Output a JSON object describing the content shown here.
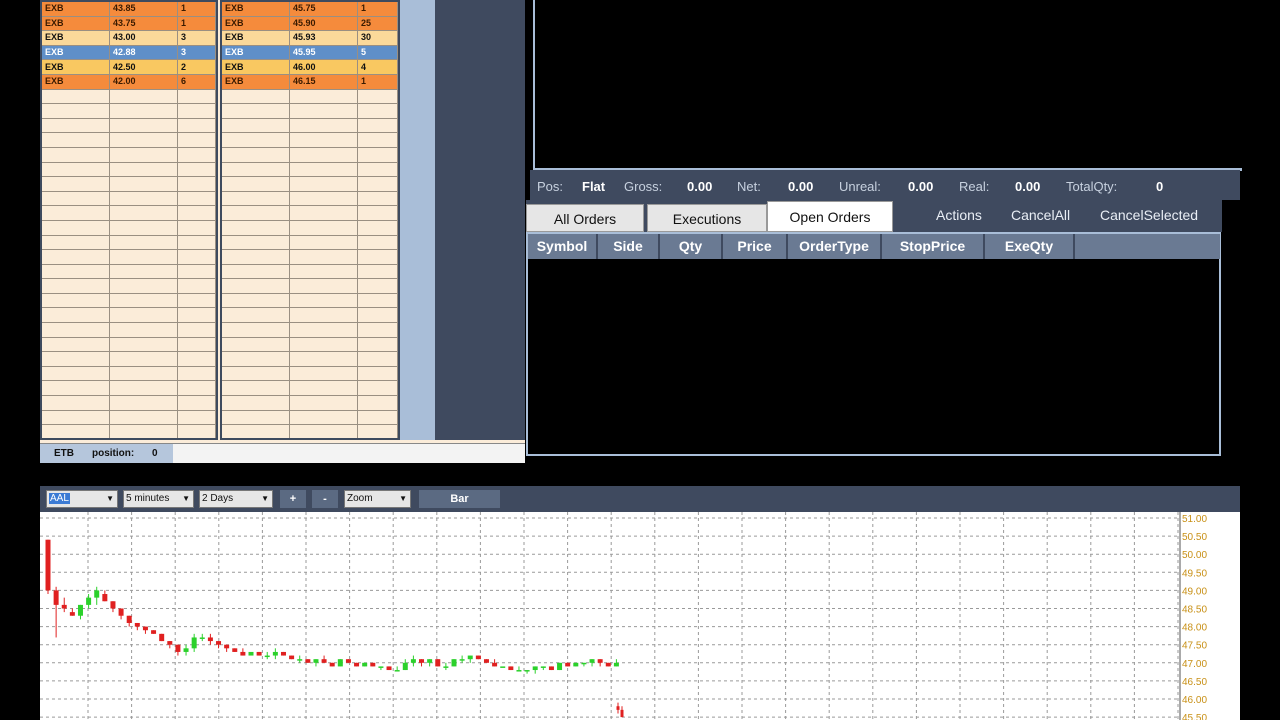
{
  "bid_book": {
    "rows": [
      {
        "ex": "EXB",
        "price": "43.85",
        "size": "1",
        "style": "orange"
      },
      {
        "ex": "EXB",
        "price": "43.75",
        "size": "1",
        "style": "orange"
      },
      {
        "ex": "EXB",
        "price": "43.00",
        "size": "3",
        "style": "light"
      },
      {
        "ex": "EXB",
        "price": "42.88",
        "size": "3",
        "style": "blue"
      },
      {
        "ex": "EXB",
        "price": "42.50",
        "size": "2",
        "style": "yellow"
      },
      {
        "ex": "EXB",
        "price": "42.00",
        "size": "6",
        "style": "orange"
      }
    ]
  },
  "ask_book": {
    "rows": [
      {
        "ex": "EXB",
        "price": "45.75",
        "size": "1",
        "style": "orange"
      },
      {
        "ex": "EXB",
        "price": "45.90",
        "size": "25",
        "style": "orange"
      },
      {
        "ex": "EXB",
        "price": "45.93",
        "size": "30",
        "style": "light"
      },
      {
        "ex": "EXB",
        "price": "45.95",
        "size": "5",
        "style": "blue"
      },
      {
        "ex": "EXB",
        "price": "46.00",
        "size": "4",
        "style": "yellow"
      },
      {
        "ex": "EXB",
        "price": "46.15",
        "size": "1",
        "style": "orange"
      }
    ]
  },
  "l2_status": {
    "symbol": "ETB",
    "position_label": "position:",
    "position_value": "0"
  },
  "position_bar": {
    "pos_label": "Pos:",
    "pos_value": "Flat",
    "gross_label": "Gross:",
    "gross_value": "0.00",
    "net_label": "Net:",
    "net_value": "0.00",
    "unreal_label": "Unreal:",
    "unreal_value": "0.00",
    "real_label": "Real:",
    "real_value": "0.00",
    "totalqty_label": "TotalQty:",
    "totalqty_value": "0"
  },
  "orders": {
    "tabs": [
      "All Orders",
      "Executions",
      "Open Orders"
    ],
    "active_tab": "Open Orders",
    "actions": [
      "Actions",
      "CancelAll",
      "CancelSelected"
    ],
    "columns": [
      "Symbol",
      "Side",
      "Qty",
      "Price",
      "OrderType",
      "StopPrice",
      "ExeQty"
    ]
  },
  "chart_toolbar": {
    "symbol": "AAL",
    "interval": "5 minutes",
    "range": "2 Days",
    "plus": "+",
    "minus": "-",
    "zoom": "Zoom",
    "bar": "Bar"
  },
  "chart_data": {
    "type": "candlestick",
    "ylim": [
      45.5,
      51.0
    ],
    "y_ticks": [
      "51.00",
      "50.50",
      "50.00",
      "49.50",
      "49.00",
      "48.50",
      "48.00",
      "47.50",
      "47.00",
      "46.50",
      "46.00",
      "45.50"
    ],
    "up_color": "#2bd12b",
    "down_color": "#e02020",
    "grid": "dashed",
    "candles": [
      [
        50.4,
        50.4,
        48.9,
        49.0
      ],
      [
        49.0,
        49.1,
        47.7,
        48.6
      ],
      [
        48.6,
        48.8,
        48.4,
        48.5
      ],
      [
        48.4,
        48.5,
        48.3,
        48.3
      ],
      [
        48.3,
        48.6,
        48.2,
        48.6
      ],
      [
        48.6,
        48.9,
        48.5,
        48.8
      ],
      [
        48.8,
        49.1,
        48.6,
        49.0
      ],
      [
        48.9,
        49.0,
        48.7,
        48.7
      ],
      [
        48.7,
        48.7,
        48.4,
        48.5
      ],
      [
        48.5,
        48.5,
        48.2,
        48.3
      ],
      [
        48.3,
        48.3,
        48.0,
        48.1
      ],
      [
        48.1,
        48.1,
        47.9,
        48.0
      ],
      [
        48.0,
        48.0,
        47.8,
        47.9
      ],
      [
        47.9,
        47.9,
        47.8,
        47.8
      ],
      [
        47.8,
        47.8,
        47.6,
        47.6
      ],
      [
        47.6,
        47.6,
        47.4,
        47.5
      ],
      [
        47.5,
        47.5,
        47.2,
        47.3
      ],
      [
        47.3,
        47.5,
        47.2,
        47.4
      ],
      [
        47.4,
        47.8,
        47.3,
        47.7
      ],
      [
        47.7,
        47.8,
        47.6,
        47.7
      ],
      [
        47.7,
        47.8,
        47.5,
        47.6
      ],
      [
        47.6,
        47.6,
        47.4,
        47.5
      ],
      [
        47.5,
        47.5,
        47.3,
        47.4
      ],
      [
        47.4,
        47.4,
        47.3,
        47.3
      ],
      [
        47.3,
        47.4,
        47.2,
        47.2
      ],
      [
        47.2,
        47.3,
        47.2,
        47.3
      ],
      [
        47.3,
        47.3,
        47.2,
        47.2
      ],
      [
        47.2,
        47.3,
        47.1,
        47.2
      ],
      [
        47.2,
        47.4,
        47.1,
        47.3
      ],
      [
        47.3,
        47.3,
        47.2,
        47.2
      ],
      [
        47.2,
        47.2,
        47.1,
        47.1
      ],
      [
        47.1,
        47.2,
        47.0,
        47.1
      ],
      [
        47.1,
        47.1,
        47.0,
        47.0
      ],
      [
        47.0,
        47.1,
        46.9,
        47.1
      ],
      [
        47.1,
        47.2,
        47.0,
        47.0
      ],
      [
        47.0,
        47.0,
        46.9,
        46.9
      ],
      [
        46.9,
        47.1,
        46.9,
        47.1
      ],
      [
        47.1,
        47.1,
        47.0,
        47.0
      ],
      [
        47.0,
        47.0,
        46.9,
        46.9
      ],
      [
        46.9,
        47.0,
        46.9,
        47.0
      ],
      [
        47.0,
        47.0,
        46.9,
        46.9
      ],
      [
        46.9,
        46.9,
        46.8,
        46.9
      ],
      [
        46.9,
        46.9,
        46.8,
        46.8
      ],
      [
        46.8,
        46.9,
        46.8,
        46.8
      ],
      [
        46.8,
        47.1,
        46.8,
        47.0
      ],
      [
        47.0,
        47.2,
        46.9,
        47.1
      ],
      [
        47.1,
        47.1,
        46.9,
        47.0
      ],
      [
        47.0,
        47.1,
        46.9,
        47.1
      ],
      [
        47.1,
        47.1,
        46.9,
        46.9
      ],
      [
        46.9,
        47.0,
        46.8,
        46.9
      ],
      [
        46.9,
        47.1,
        46.9,
        47.1
      ],
      [
        47.1,
        47.2,
        47.0,
        47.1
      ],
      [
        47.1,
        47.2,
        47.0,
        47.2
      ],
      [
        47.2,
        47.2,
        47.1,
        47.1
      ],
      [
        47.1,
        47.1,
        47.0,
        47.0
      ],
      [
        47.0,
        47.1,
        46.9,
        46.9
      ],
      [
        46.9,
        46.9,
        46.9,
        46.9
      ],
      [
        46.9,
        46.9,
        46.8,
        46.8
      ],
      [
        46.8,
        46.9,
        46.8,
        46.8
      ],
      [
        46.8,
        46.8,
        46.7,
        46.8
      ],
      [
        46.8,
        46.9,
        46.7,
        46.9
      ],
      [
        46.9,
        46.9,
        46.8,
        46.9
      ],
      [
        46.9,
        46.9,
        46.8,
        46.8
      ],
      [
        46.8,
        47.0,
        46.8,
        47.0
      ],
      [
        47.0,
        47.0,
        46.9,
        46.9
      ],
      [
        46.9,
        47.0,
        46.9,
        47.0
      ],
      [
        47.0,
        47.0,
        46.9,
        47.0
      ],
      [
        47.0,
        47.1,
        46.9,
        47.1
      ],
      [
        47.1,
        47.1,
        46.9,
        47.0
      ],
      [
        47.0,
        47.0,
        46.9,
        46.9
      ],
      [
        46.9,
        47.1,
        46.9,
        47.0
      ]
    ],
    "late_candles": [
      [
        45.8,
        45.9,
        45.6,
        45.7
      ],
      [
        45.7,
        45.8,
        45.5,
        45.5
      ]
    ]
  }
}
